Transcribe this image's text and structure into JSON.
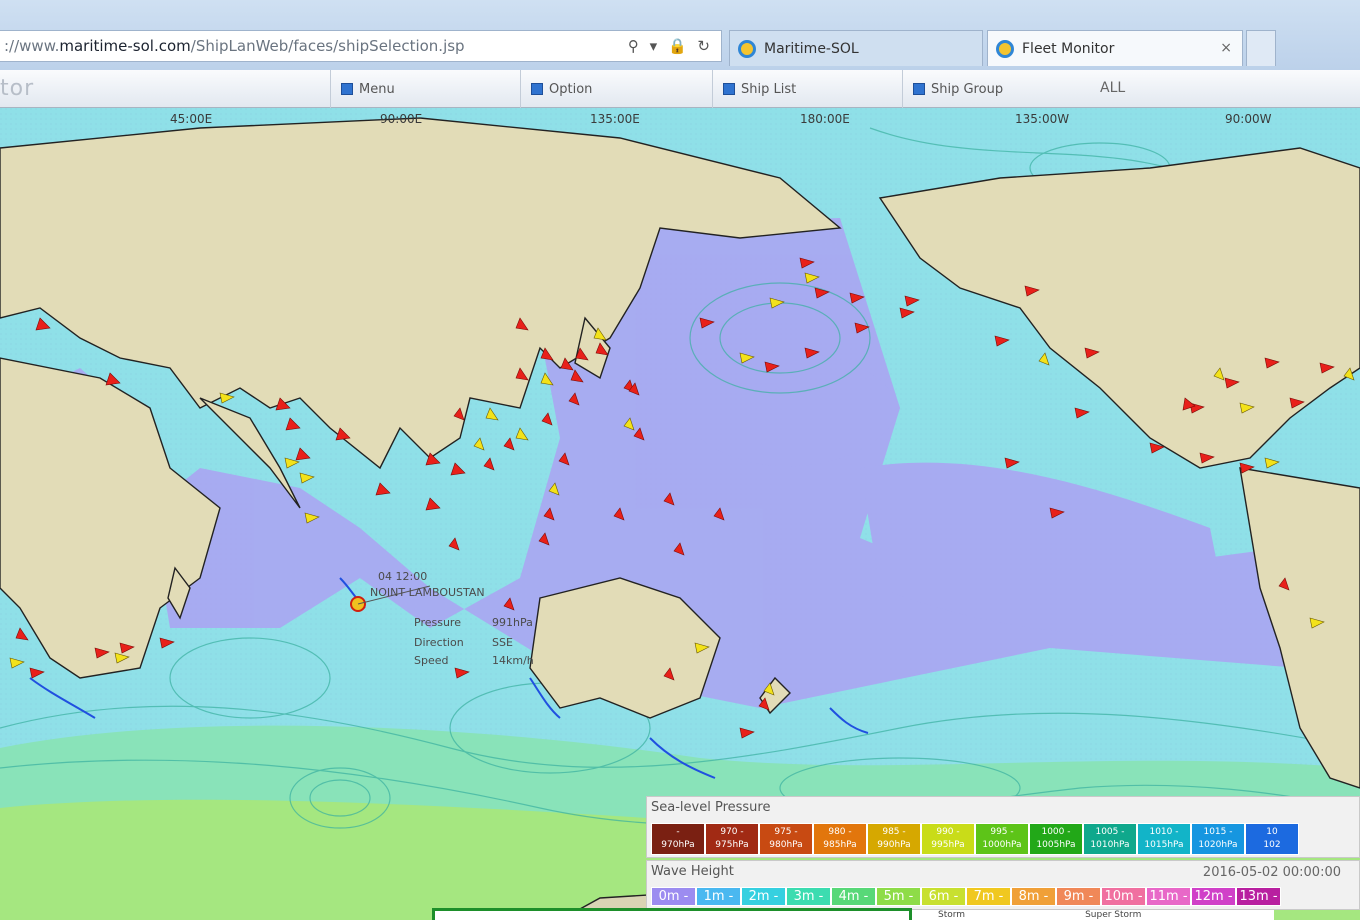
{
  "browser": {
    "url_prefix": "://www.",
    "url_domain": "maritime-sol.com",
    "url_path": "/ShipLanWeb/faces/shipSelection.jsp",
    "url_icons": "⚲ ▾ 🔒 ↻",
    "tabs": [
      {
        "label": "Maritime-SOL"
      },
      {
        "label": "Fleet Monitor",
        "close": "×"
      }
    ]
  },
  "app": {
    "title": "tor",
    "menu_label": "Menu",
    "option_label": "Option",
    "ship_list_label": "Ship List",
    "ship_group_label": "Ship Group",
    "ship_group_value": "ALL"
  },
  "map": {
    "longitudes": [
      "45:00E",
      "90:00E",
      "135:00E",
      "180:00E",
      "135:00W",
      "90:00W"
    ],
    "storm": {
      "time": "04 12:00",
      "name_line": "NOINT LAMBOUSTAN",
      "pressure_label": "Pressure",
      "pressure_value": "991hPa",
      "direction_label": "Direction",
      "direction_value": "SSE",
      "speed_label": "Speed",
      "speed_value": "14km/h"
    },
    "colors": {
      "ship_red": "#e8201a",
      "ship_yellow": "#f3e21a",
      "land": "#e2dcb7",
      "ocean_light": "#8fe0e8",
      "ocean_purple": "#a8a7f0"
    }
  },
  "legend": {
    "pressure_title": "Sea-level Pressure",
    "pressure_bins": [
      {
        "label": "-\n970hPa",
        "color": "#7a2012"
      },
      {
        "label": "970 -\n975hPa",
        "color": "#a12a14"
      },
      {
        "label": "975 -\n980hPa",
        "color": "#c84a12"
      },
      {
        "label": "980 -\n985hPa",
        "color": "#e2760c"
      },
      {
        "label": "985 -\n990hPa",
        "color": "#d6a800"
      },
      {
        "label": "990 -\n995hPa",
        "color": "#c9dc18"
      },
      {
        "label": "995 -\n1000hPa",
        "color": "#5dc418"
      },
      {
        "label": "1000 -\n1005hPa",
        "color": "#22a818"
      },
      {
        "label": "1005 -\n1010hPa",
        "color": "#0fa88c"
      },
      {
        "label": "1010 -\n1015hPa",
        "color": "#12b4c8"
      },
      {
        "label": "1015 -\n1020hPa",
        "color": "#1696e0"
      },
      {
        "label": "10\n102",
        "color": "#1c6ae0"
      }
    ],
    "wave_title": "Wave Height",
    "wave_date": "2016-05-02 00:00:00",
    "wave_bins": [
      {
        "label": "0m -",
        "color": "#9c8cf0"
      },
      {
        "label": "1m -",
        "color": "#4ab8f0"
      },
      {
        "label": "2m -",
        "color": "#36d0e0"
      },
      {
        "label": "3m -",
        "color": "#3cdcb0"
      },
      {
        "label": "4m -",
        "color": "#58d878"
      },
      {
        "label": "5m -",
        "color": "#8edc48"
      },
      {
        "label": "6m -",
        "color": "#c8e030"
      },
      {
        "label": "7m -",
        "color": "#f0c820"
      },
      {
        "label": "8m -",
        "color": "#f0a038"
      },
      {
        "label": "9m -",
        "color": "#f08858"
      },
      {
        "label": "10m -",
        "color": "#f070a0"
      },
      {
        "label": "11m -",
        "color": "#e868c8"
      },
      {
        "label": "12m -",
        "color": "#d040c8"
      },
      {
        "label": "13m -",
        "color": "#b820a0"
      }
    ],
    "storm_label": "Storm",
    "super_storm_label": "Super Storm"
  }
}
